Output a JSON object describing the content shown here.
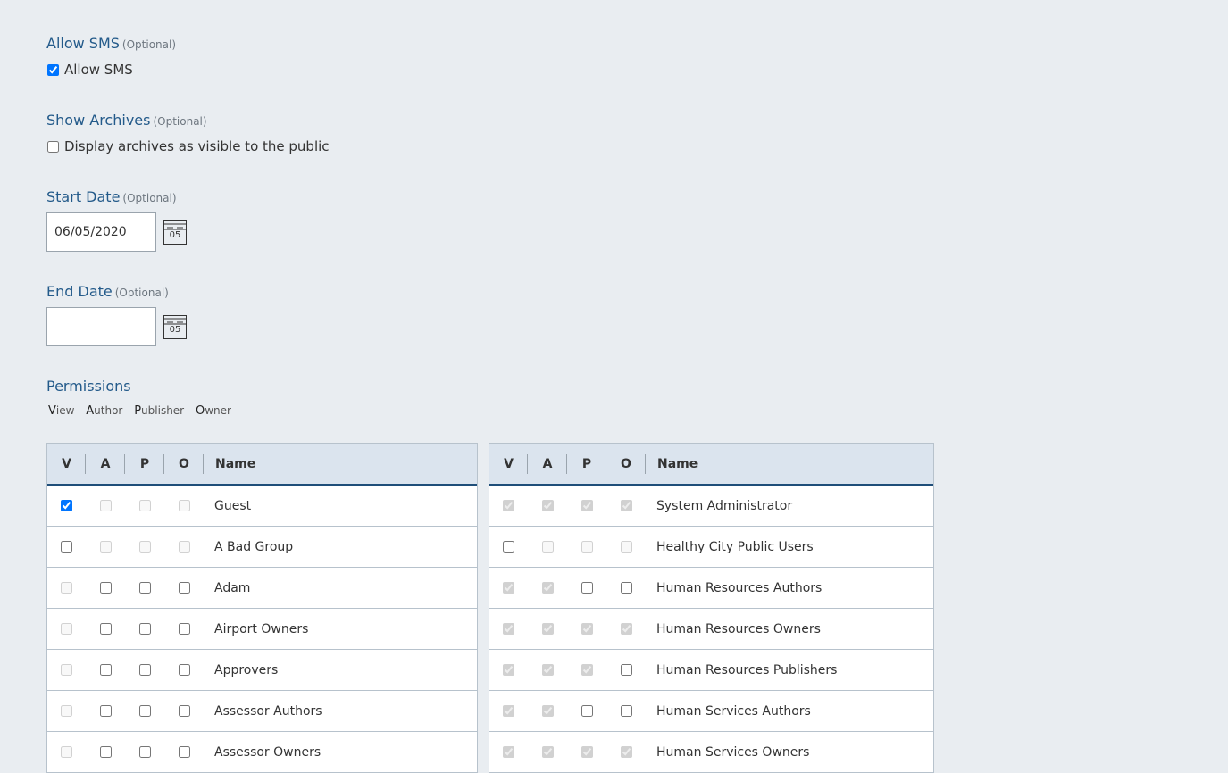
{
  "allow_sms": {
    "label": "Allow SMS",
    "optional": "(Optional)",
    "checkbox_label": "Allow SMS",
    "checked": true
  },
  "show_archives": {
    "label": "Show Archives",
    "optional": "(Optional)",
    "checkbox_label": "Display archives as visible to the public",
    "checked": false
  },
  "start_date": {
    "label": "Start Date",
    "optional": "(Optional)",
    "value": "06/05/2020",
    "calendar_day": "05"
  },
  "end_date": {
    "label": "End Date",
    "optional": "(Optional)",
    "value": "",
    "calendar_day": "05"
  },
  "permissions": {
    "label": "Permissions",
    "legend": [
      {
        "key": "V",
        "rest": "iew"
      },
      {
        "key": "A",
        "rest": "uthor"
      },
      {
        "key": "P",
        "rest": "ublisher"
      },
      {
        "key": "O",
        "rest": "wner"
      }
    ],
    "columns": [
      "V",
      "A",
      "P",
      "O",
      "Name"
    ],
    "left_rows": [
      {
        "name": "Guest",
        "v": "checked",
        "a": "disabled",
        "p": "disabled",
        "o": "disabled"
      },
      {
        "name": "A Bad Group",
        "v": "unchecked",
        "a": "disabled",
        "p": "disabled",
        "o": "disabled"
      },
      {
        "name": "Adam",
        "v": "disabled",
        "a": "unchecked",
        "p": "unchecked",
        "o": "unchecked"
      },
      {
        "name": "Airport Owners",
        "v": "disabled",
        "a": "unchecked",
        "p": "unchecked",
        "o": "unchecked"
      },
      {
        "name": "Approvers",
        "v": "disabled",
        "a": "unchecked",
        "p": "unchecked",
        "o": "unchecked"
      },
      {
        "name": "Assessor Authors",
        "v": "disabled",
        "a": "unchecked",
        "p": "unchecked",
        "o": "unchecked"
      },
      {
        "name": "Assessor Owners",
        "v": "disabled",
        "a": "unchecked",
        "p": "unchecked",
        "o": "unchecked"
      }
    ],
    "right_rows": [
      {
        "name": "System Administrator",
        "v": "disabled-checked",
        "a": "disabled-checked",
        "p": "disabled-checked",
        "o": "disabled-checked"
      },
      {
        "name": "Healthy City Public Users",
        "v": "unchecked",
        "a": "disabled",
        "p": "disabled",
        "o": "disabled"
      },
      {
        "name": "Human Resources Authors",
        "v": "disabled-checked",
        "a": "disabled-checked",
        "p": "unchecked",
        "o": "unchecked"
      },
      {
        "name": "Human Resources Owners",
        "v": "disabled-checked",
        "a": "disabled-checked",
        "p": "disabled-checked",
        "o": "disabled-checked"
      },
      {
        "name": "Human Resources Publishers",
        "v": "disabled-checked",
        "a": "disabled-checked",
        "p": "disabled-checked",
        "o": "unchecked"
      },
      {
        "name": "Human Services Authors",
        "v": "disabled-checked",
        "a": "disabled-checked",
        "p": "unchecked",
        "o": "unchecked"
      },
      {
        "name": "Human Services Owners",
        "v": "disabled-checked",
        "a": "disabled-checked",
        "p": "disabled-checked",
        "o": "disabled-checked"
      }
    ]
  }
}
